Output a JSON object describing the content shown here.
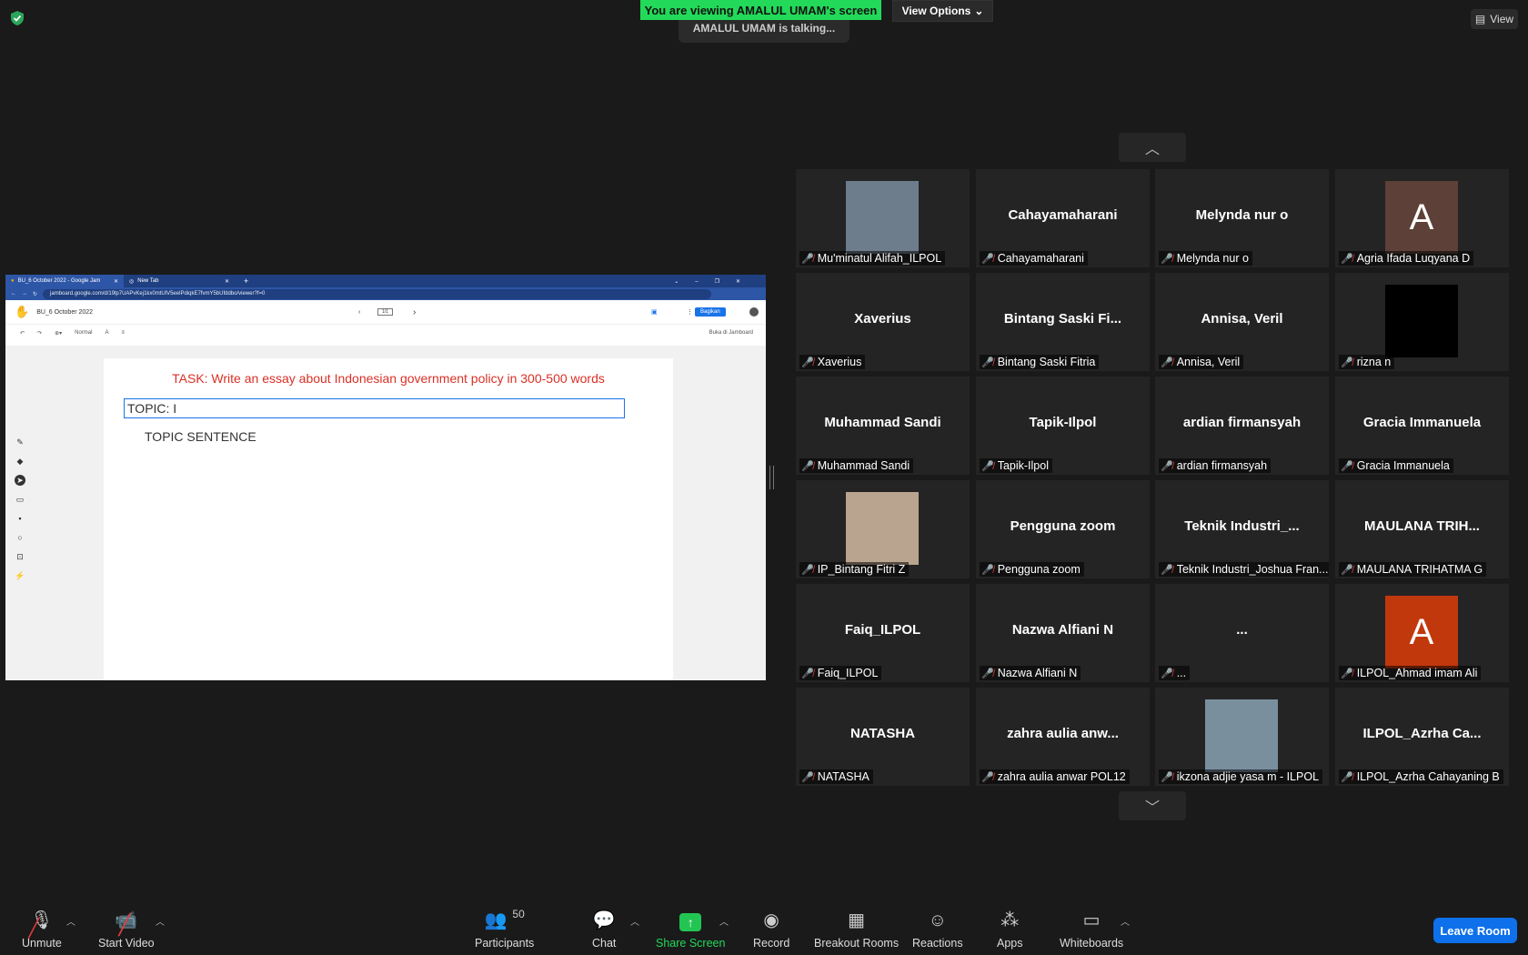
{
  "banner": {
    "viewing": "You are viewing AMALUL UMAM's screen",
    "view_options": "View Options",
    "talking": "AMALUL UMAM is talking...",
    "view": "View"
  },
  "browser": {
    "tabs": [
      "BU_6 October 2022 - Google Jam",
      "New Tab"
    ],
    "url": "jamboard.google.com/d/19lp7UAPvKej1kx0mtUlV5eelPdiqkE7fvmY5bUfddbo/viewer?f=0",
    "doc_title": "BU_6 October 2022",
    "page_indicator": "1/1",
    "share_button": "Bagikan",
    "font_style": "Normal",
    "open_in_jamboard": "Buka di Jamboard",
    "task_text": "TASK: Write an essay about Indonesian government policy in 300-500 words",
    "topic_text": "TOPIC: I",
    "topic_sentence": "TOPIC SENTENCE"
  },
  "participants_grid": [
    {
      "name": "",
      "label": "Mu'minatul Alifah_ILPOL",
      "avatar": "photo",
      "avatar_color": "#6d7d8c"
    },
    {
      "name": "Cahayamaharani",
      "label": "Cahayamaharani"
    },
    {
      "name": "Melynda nur o",
      "label": "Melynda nur o"
    },
    {
      "name": "",
      "label": "Agria Ifada Luqyana D",
      "avatar": "A",
      "avatar_color": "#5d4037"
    },
    {
      "name": "Xaverius",
      "label": "Xaverius"
    },
    {
      "name": "Bintang Saski Fi...",
      "label": "Bintang Saski Fitria"
    },
    {
      "name": "Annisa, Veril",
      "label": "Annisa, Veril"
    },
    {
      "name": "",
      "label": "rizna n",
      "avatar": "",
      "avatar_color": "#000000"
    },
    {
      "name": "Muhammad Sandi",
      "label": "Muhammad Sandi"
    },
    {
      "name": "Tapik-Ilpol",
      "label": "Tapik-Ilpol"
    },
    {
      "name": "ardian firmansyah",
      "label": "ardian firmansyah"
    },
    {
      "name": "Gracia Immanuela",
      "label": "Gracia Immanuela"
    },
    {
      "name": "",
      "label": "IP_Bintang Fitri Z",
      "avatar": "photo",
      "avatar_color": "#b9a58f"
    },
    {
      "name": "Pengguna zoom",
      "label": "Pengguna zoom"
    },
    {
      "name": "Teknik  Industri_...",
      "label": "Teknik Industri_Joshua Fran..."
    },
    {
      "name": "MAULANA TRIH...",
      "label": "MAULANA TRIHATMA G"
    },
    {
      "name": "Faiq_ILPOL",
      "label": "Faiq_ILPOL"
    },
    {
      "name": "Nazwa Alfiani N",
      "label": "Nazwa Alfiani N"
    },
    {
      "name": "...",
      "label": "..."
    },
    {
      "name": "",
      "label": "ILPOL_Ahmad imam Ali",
      "avatar": "A",
      "avatar_color": "#c1380c"
    },
    {
      "name": "NATASHA",
      "label": "NATASHA"
    },
    {
      "name": "zahra aulia anw...",
      "label": "zahra aulia anwar POL12"
    },
    {
      "name": "",
      "label": "ikzona adjie yasa m - ILPOL",
      "avatar": "photo",
      "avatar_color": "#7a8f9e"
    },
    {
      "name": "ILPOL_Azrha Ca...",
      "label": "ILPOL_Azrha Cahayaning B"
    }
  ],
  "toolbar": {
    "unmute": "Unmute",
    "start_video": "Start Video",
    "participants": "Participants",
    "participants_count": "50",
    "chat": "Chat",
    "share_screen": "Share Screen",
    "record": "Record",
    "breakout_rooms": "Breakout Rooms",
    "reactions": "Reactions",
    "apps": "Apps",
    "whiteboards": "Whiteboards",
    "leave_room": "Leave Room"
  }
}
